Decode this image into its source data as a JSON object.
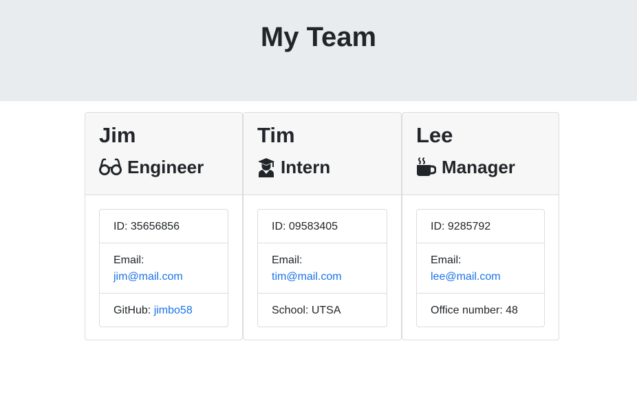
{
  "header": {
    "title": "My Team"
  },
  "employees": [
    {
      "name": "Jim",
      "role": "Engineer",
      "icon": "glasses-icon",
      "id_label": "ID: ",
      "id": "35656856",
      "email_label": "Email:",
      "email": "jim@mail.com",
      "extra_label": "GitHub: ",
      "extra_value": "jimbo58"
    },
    {
      "name": "Tim",
      "role": "Intern",
      "icon": "graduate-icon",
      "id_label": "ID: ",
      "id": "09583405",
      "email_label": "Email:",
      "email": "tim@mail.com",
      "extra_label": "School: ",
      "extra_value": "UTSA"
    },
    {
      "name": "Lee",
      "role": "Manager",
      "icon": "coffee-mug-icon",
      "id_label": "ID: ",
      "id": "9285792",
      "email_label": "Email:",
      "email": "lee@mail.com",
      "extra_label": "Office number: ",
      "extra_value": "48"
    }
  ],
  "colors": {
    "jumbotron": "#e9ecef",
    "card_header": "#f7f7f7",
    "link": "#1a73e8",
    "text": "#212529"
  }
}
